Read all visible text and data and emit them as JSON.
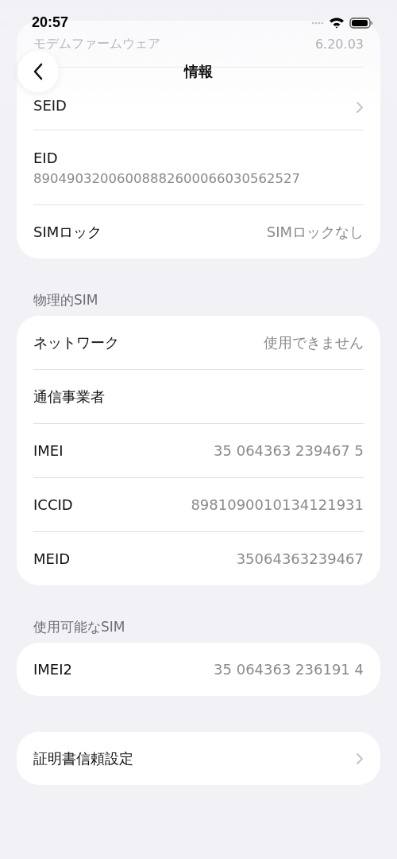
{
  "status_bar": {
    "time": "20:57"
  },
  "nav": {
    "title": "情報"
  },
  "groups": [
    {
      "rows": [
        {
          "kind": "faded",
          "label": "モデムファームウェア",
          "value": "6.20.03",
          "chevron": false
        },
        {
          "kind": "row",
          "label": "SEID",
          "value": null,
          "chevron": true
        },
        {
          "kind": "stacked",
          "label": "EID",
          "value": "89049032006008882600066030562527"
        },
        {
          "kind": "row",
          "label": "SIMロック",
          "value": "SIMロックなし",
          "chevron": false
        }
      ]
    },
    {
      "header": "物理的SIM",
      "rows": [
        {
          "kind": "row",
          "label": "ネットワーク",
          "value": "使用できません",
          "chevron": false
        },
        {
          "kind": "row",
          "label": "通信事業者",
          "value": null,
          "chevron": false
        },
        {
          "kind": "row",
          "label": "IMEI",
          "value": "35 064363 239467 5",
          "chevron": false
        },
        {
          "kind": "row",
          "label": "ICCID",
          "value": "8981090010134121931",
          "chevron": false
        },
        {
          "kind": "row",
          "label": "MEID",
          "value": "35064363239467",
          "chevron": false
        }
      ]
    },
    {
      "header": "使用可能なSIM",
      "rows": [
        {
          "kind": "row",
          "label": "IMEI2",
          "value": "35 064363 236191 4",
          "chevron": false
        }
      ]
    },
    {
      "rows": [
        {
          "kind": "row",
          "label": "証明書信頼設定",
          "value": null,
          "chevron": true
        }
      ]
    }
  ]
}
